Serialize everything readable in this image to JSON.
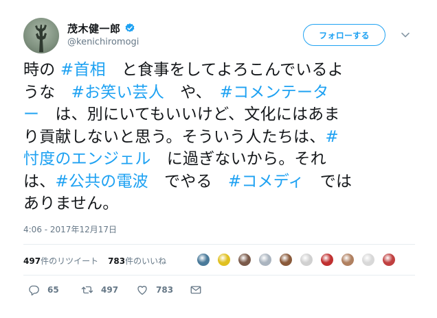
{
  "user": {
    "display_name": "茂木健一郎",
    "handle": "@kenichiromogi",
    "verified": true
  },
  "follow_button": {
    "label": "フォローする"
  },
  "tweet": {
    "lines": [
      [
        {
          "t": "時の ",
          "h": false
        },
        {
          "t": "#首相",
          "h": true
        },
        {
          "t": "　と食事をしてよろこんでいるよ",
          "h": false
        }
      ],
      [
        {
          "t": "うな　",
          "h": false
        },
        {
          "t": "#お笑い芸人",
          "h": true
        },
        {
          "t": "　や、　",
          "h": false
        },
        {
          "t": "#コメンテータ",
          "h": true
        }
      ],
      [
        {
          "t": "ー",
          "h": true
        },
        {
          "t": "　は、別にいてもいいけど、文化にはあま",
          "h": false
        }
      ],
      [
        {
          "t": "り貢献しないと思う。そういう人たちは、",
          "h": false
        },
        {
          "t": "#",
          "h": true
        }
      ],
      [
        {
          "t": "忖度のエンジェル",
          "h": true
        },
        {
          "t": "　に過ぎないから。それ",
          "h": false
        }
      ],
      [
        {
          "t": "は、",
          "h": false
        },
        {
          "t": "#公共の電波",
          "h": true
        },
        {
          "t": "　でやる　",
          "h": false
        },
        {
          "t": "#コメディ",
          "h": true
        },
        {
          "t": "　では",
          "h": false
        }
      ],
      [
        {
          "t": "ありません。",
          "h": false
        }
      ]
    ],
    "timestamp": "4:06 - 2017年12月17日"
  },
  "stats": {
    "retweets_count": "497",
    "retweets_label": "件のリツイート",
    "likes_count": "783",
    "likes_label": "件のいいね"
  },
  "liker_avatars": [
    {
      "color": "#4a7a9a"
    },
    {
      "color": "#e0c020"
    },
    {
      "color": "#7a5a4a"
    },
    {
      "color": "#aab4bf"
    },
    {
      "color": "#8a5a3a"
    },
    {
      "color": "#d0d0d0"
    },
    {
      "color": "#c03030"
    },
    {
      "color": "#b08060"
    },
    {
      "color": "#d8d8d8"
    },
    {
      "color": "#c04040"
    }
  ],
  "actions": {
    "reply_count": "65",
    "retweet_count": "497",
    "like_count": "783"
  },
  "colors": {
    "accent": "#1da1f2",
    "text": "#14171a",
    "secondary": "#657786"
  }
}
